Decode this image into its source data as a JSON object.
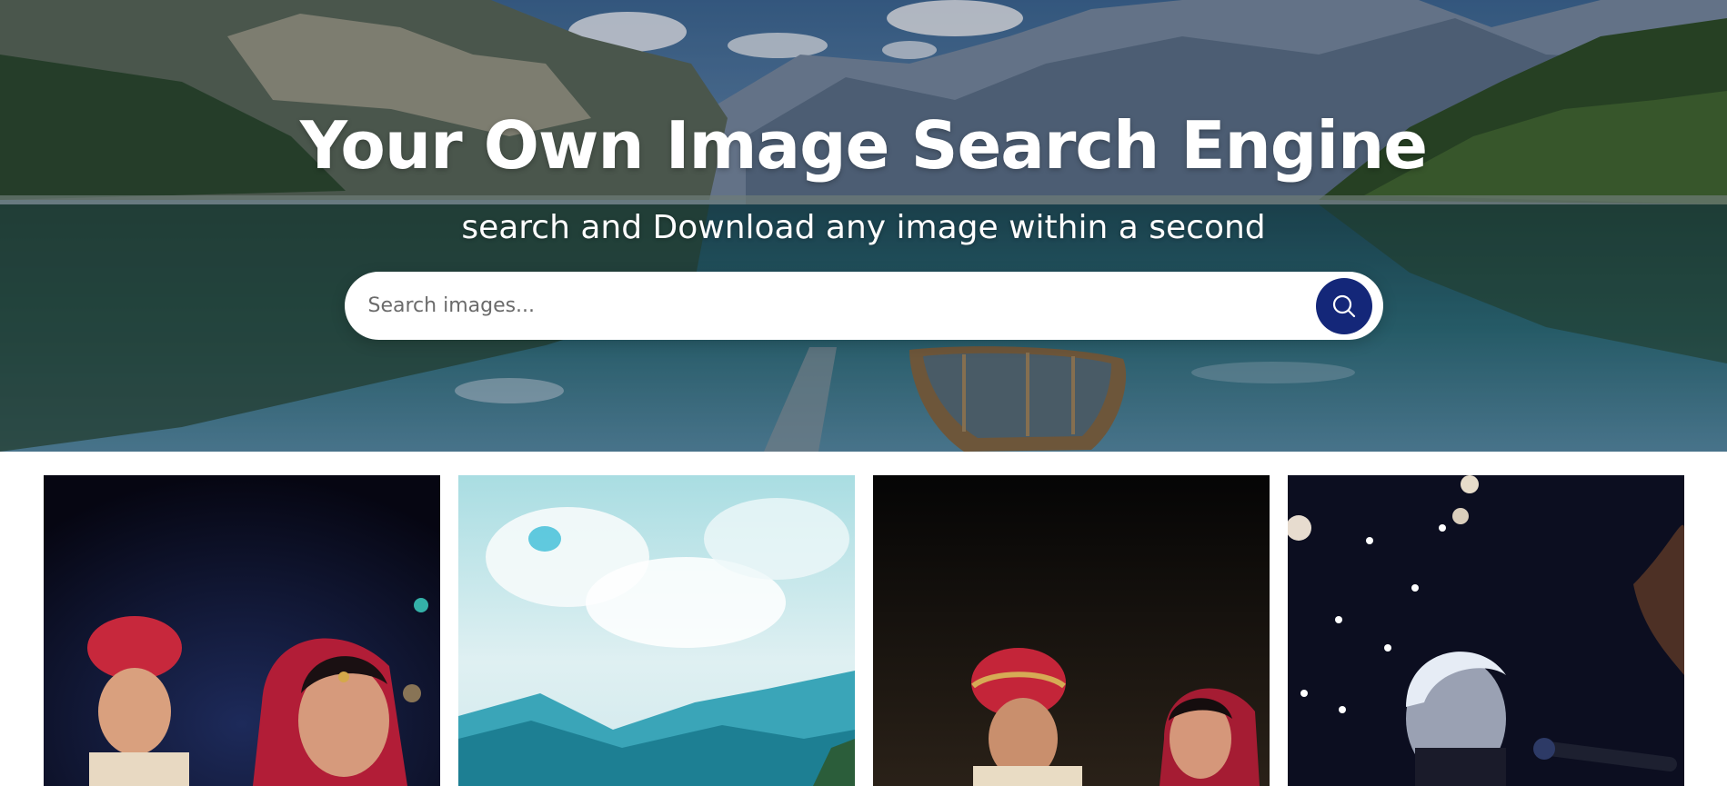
{
  "hero": {
    "title": "Your Own Image Search Engine",
    "subtitle": "search and Download any image within a second",
    "background_icon": "mountain-lake-photo"
  },
  "search": {
    "placeholder": "Search images...",
    "value": "",
    "button_icon": "search-icon",
    "button_color": "#142779"
  },
  "results": [
    {
      "subject": "wedding-couple-photo"
    },
    {
      "subject": "cloudy-sky-mountains-photo"
    },
    {
      "subject": "wedding-couple-photo"
    },
    {
      "subject": "singer-with-microphone-photo"
    }
  ]
}
